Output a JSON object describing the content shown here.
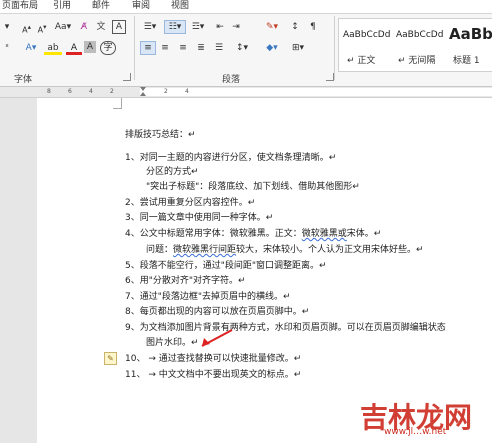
{
  "tabs": [
    "页面布局",
    "引用",
    "邮件",
    "审阅",
    "视图"
  ],
  "groups": {
    "font": "字体",
    "paragraph": "段落"
  },
  "styles": [
    {
      "sample": "AaBbCcDd",
      "name": "↵ 正文"
    },
    {
      "sample": "AaBbCcDd",
      "name": "↵ 无间隔"
    },
    {
      "sample": "AaBb",
      "name": "标题 1"
    }
  ],
  "ruler": [
    "8",
    "6",
    "4",
    "2",
    "2",
    "4"
  ],
  "document": {
    "heading": "排版技巧总结：↵",
    "lines": [
      "1、对同一主题的内容进行分区，使文档条理清晰。↵",
      "分区的方式↵",
      "\"突出子标题\"：段落底纹、加下划线、借助其他图形↵",
      "2、尝试用重复分区内容控件。↵",
      "3、同一篇文章中使用同一种字体。↵",
      "4、公文中标题常用字体：",
      "微软雅黑",
      "。正文：",
      "微软雅黑或",
      "宋体。↵",
      "问题：",
      "微软雅黑行间距",
      "较大，宋体较小。个人认为正文用宋体好些。↵",
      "5、段落不能空行，通过\"段间距\"窗口调整距离。↵",
      "6、用\"分散对齐\"对齐字符。↵",
      "7、通过\"段落边框\"去掉页眉中的横线。↵",
      "8、每页都出现的内容可以放在页眉页脚中。↵",
      "9、为文档添加图片背景有两种方式，水印和页眉页脚。可以在页眉页脚编辑状态",
      "图片水印。↵",
      "10、 →  通过查找替换可以快速批量修改。↵",
      "11、 →  中文文档中不要出现英文的标点。↵"
    ]
  },
  "watermark": {
    "text": "吉林龙网",
    "url": "www.jl…w.net"
  }
}
